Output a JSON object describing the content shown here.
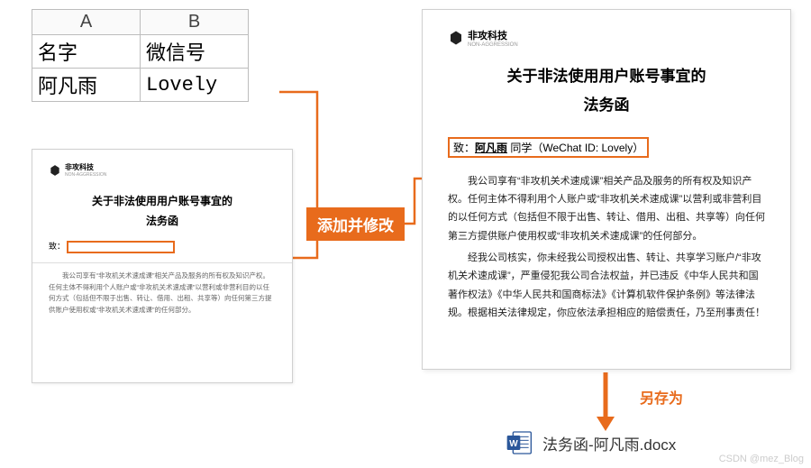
{
  "excel": {
    "col_a": "A",
    "col_b": "B",
    "header_name": "名字",
    "header_wechat": "微信号",
    "row1_name": "阿凡雨",
    "row1_wechat": "Lovely"
  },
  "company": {
    "name": "非攻科技",
    "sub": "NON-AGGRESSION"
  },
  "doc": {
    "title_line1": "关于非法使用用户账号事宜的",
    "title_line2": "法务函",
    "to_prefix": "致：",
    "to_name": "阿凡雨",
    "to_suffix": "同学（WeChat ID: Lovely）",
    "para1": "我公司享有“非攻机关术速成课”相关产品及服务的所有权及知识产权。任何主体不得利用个人账户或“非攻机关术速成课”以营利或非营利目的以任何方式（包括但不限于出售、转让、借用、出租、共享等）向任何第三方提供账户使用权或“非攻机关术速成课”的任何部分。",
    "para2": "经我公司核实，你未经我公司授权出售、转让、共享学习账户/“非攻机关术速成课”，严重侵犯我公司合法权益，并已违反《中华人民共和国著作权法》《中华人民共和国商标法》《计算机软件保护条例》等法律法规。根据相关法律规定，你应依法承担相应的赔偿责任，乃至刑事责任！"
  },
  "labels": {
    "add_modify": "添加并修改",
    "save_as": "另存为"
  },
  "output_file": {
    "name": "法务函-阿凡雨.docx"
  },
  "watermark": "CSDN @mez_Blog"
}
